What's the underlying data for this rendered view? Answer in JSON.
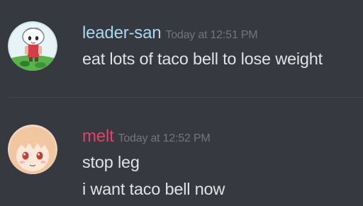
{
  "messages": [
    {
      "author": "leader-san",
      "timestamp": "Today at 12:51 PM",
      "lines": [
        "eat lots of taco bell to lose weight"
      ],
      "avatar_icon": "anime-chibi-avatar-icon",
      "name_color": "#a9d7ee"
    },
    {
      "author": "melt",
      "timestamp": "Today at 12:52 PM",
      "lines": [
        "stop leg",
        "i want taco bell now"
      ],
      "avatar_icon": "anime-girl-avatar-icon",
      "name_color": "#ed3b6a"
    }
  ],
  "colors": {
    "background": "#36393f",
    "divider": "#42454a",
    "text": "#dcddde",
    "timestamp": "#72767d"
  }
}
